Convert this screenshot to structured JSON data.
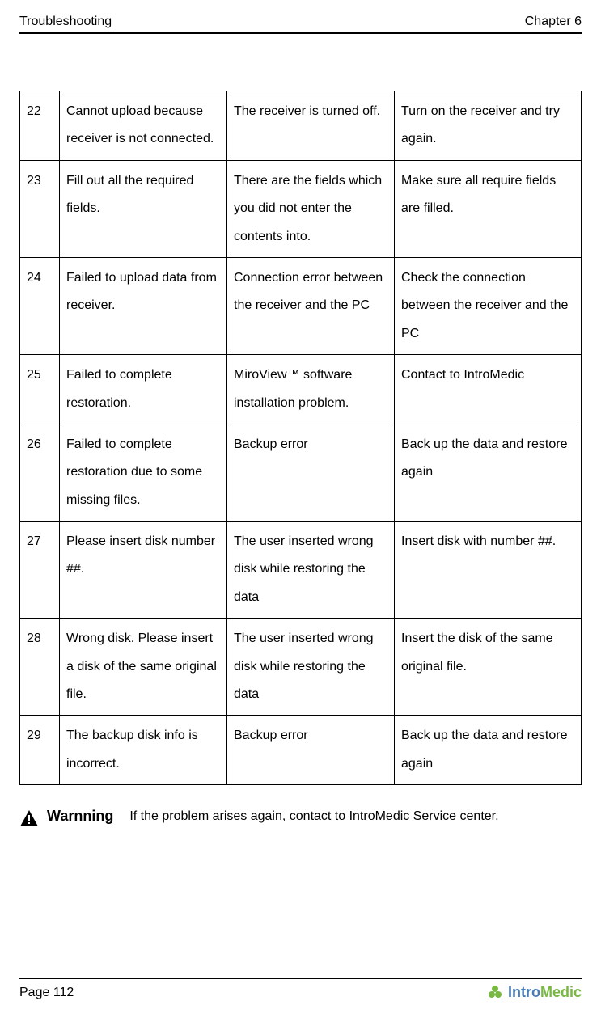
{
  "header": {
    "left": "Troubleshooting",
    "right": "Chapter 6"
  },
  "rows": [
    {
      "num": "22",
      "msg": "Cannot upload because receiver is not connected.",
      "cause": "The receiver is turned off.",
      "action": "Turn on the receiver and try again."
    },
    {
      "num": "23",
      "msg": "Fill out all the required fields.",
      "cause": "There are the fields which you did not enter the contents into.",
      "action": "Make sure all require fields are filled."
    },
    {
      "num": "24",
      "msg": "Failed to upload data from receiver.",
      "cause": "Connection error between the receiver and the PC",
      "action": "Check the connection between the receiver and the PC"
    },
    {
      "num": "25",
      "msg": "Failed to complete restoration.",
      "cause": "MiroView™ software installation problem.",
      "action": "Contact to IntroMedic"
    },
    {
      "num": "26",
      "msg": "Failed to complete restoration due to some missing files.",
      "cause": "Backup error",
      "action": "Back up the data and restore again"
    },
    {
      "num": "27",
      "msg": "Please insert disk number ##.",
      "cause": "The user inserted wrong disk while restoring the data",
      "action": "Insert disk with number ##."
    },
    {
      "num": "28",
      "msg": "Wrong disk. Please insert a disk of the same original file.",
      "cause": "The user inserted wrong disk while restoring the data",
      "action": "Insert the disk of the same original file."
    },
    {
      "num": "29",
      "msg": "The backup disk info is incorrect.",
      "cause": "Backup error",
      "action": "Back up the data and restore again"
    }
  ],
  "warning": {
    "label": "Warnning",
    "text": "If the problem arises again, contact to IntroMedic Service center."
  },
  "footer": {
    "page": "Page 112",
    "logo_intro": "Intro",
    "logo_medic": "Medic"
  }
}
